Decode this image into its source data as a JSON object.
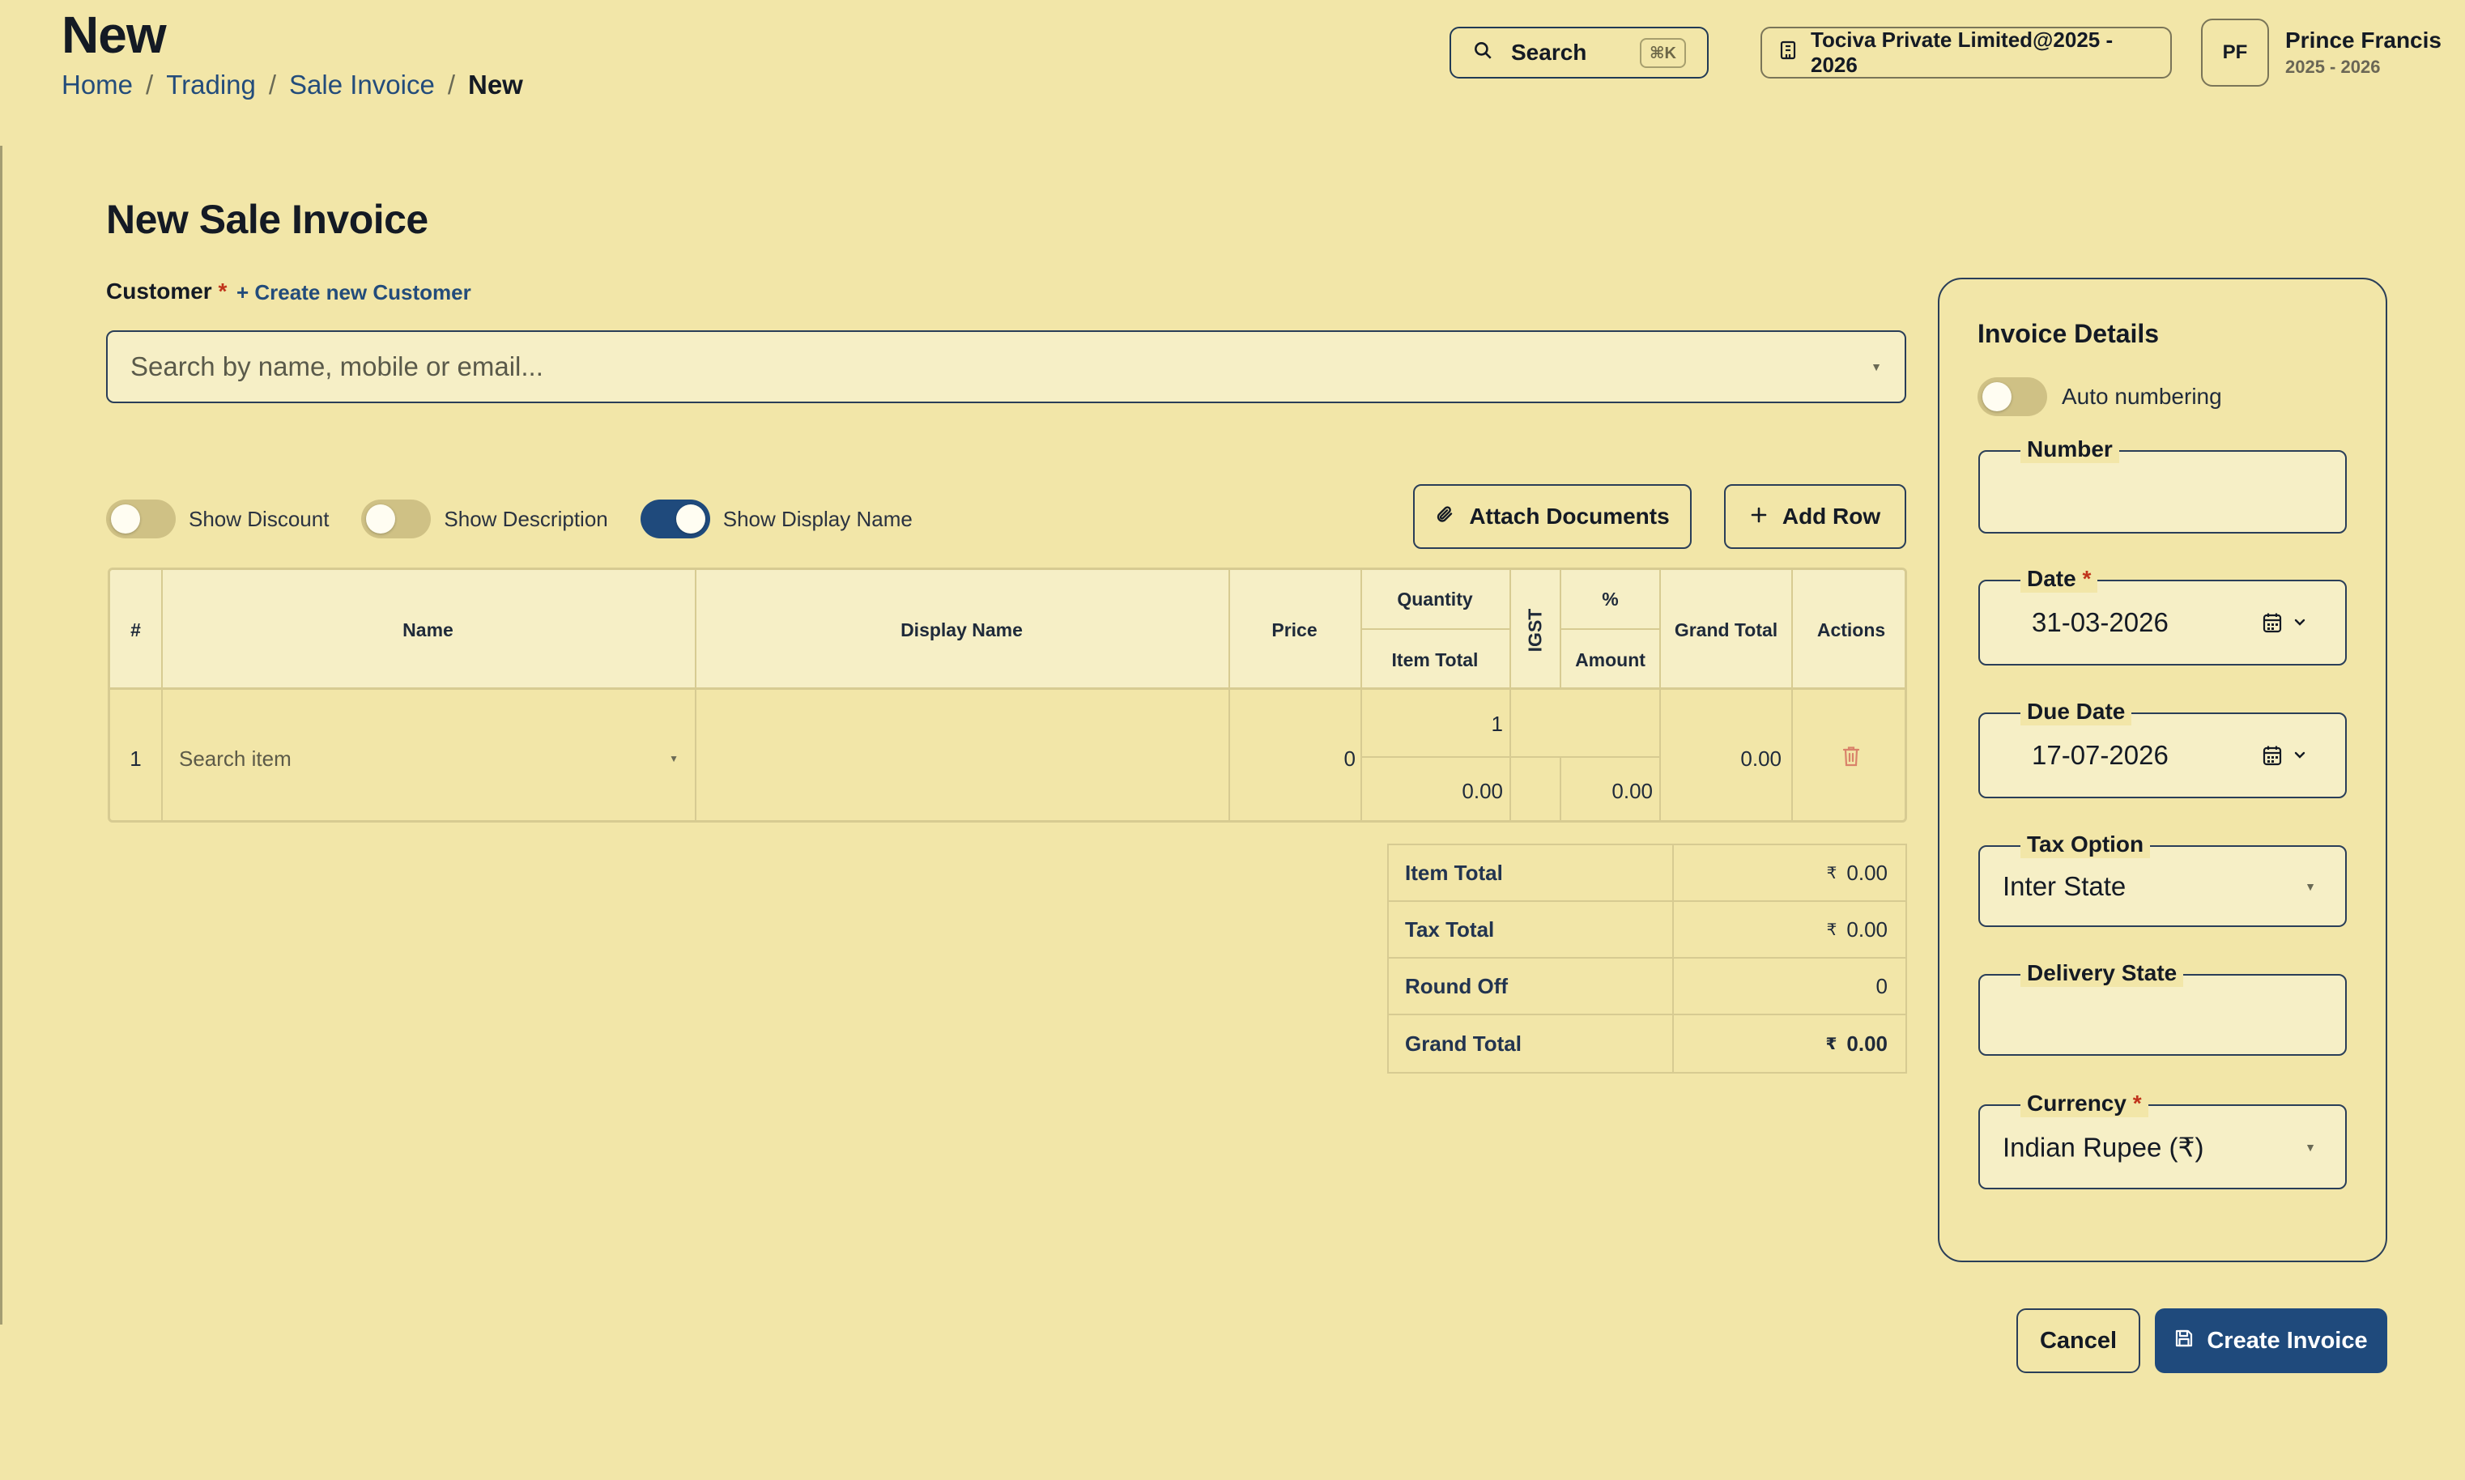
{
  "header": {
    "page_heading": "New",
    "breadcrumb": [
      "Home",
      "Trading",
      "Sale Invoice",
      "New"
    ],
    "search_label": "Search",
    "search_shortcut": "⌘K",
    "company": "Tociva Private Limited@2025 - 2026",
    "user": {
      "initials": "PF",
      "name": "Prince Francis",
      "period": "2025 - 2026"
    }
  },
  "form": {
    "title": "New Sale Invoice",
    "customer_label": "Customer",
    "required_mark": "*",
    "create_customer_link": "+ Create new Customer",
    "customer_placeholder": "Search by name, mobile or email..."
  },
  "toggles": [
    {
      "label": "Show Discount",
      "on": false
    },
    {
      "label": "Show Description",
      "on": false
    },
    {
      "label": "Show Display Name",
      "on": true
    }
  ],
  "actions": {
    "attach": "Attach Documents",
    "add_row": "Add Row"
  },
  "table": {
    "headers": {
      "index": "#",
      "name": "Name",
      "display_name": "Display Name",
      "price": "Price",
      "quantity": "Quantity",
      "item_total": "Item Total",
      "tax": "IGST",
      "percent": "%",
      "amount": "Amount",
      "grand_total": "Grand Total",
      "actions": "Actions"
    },
    "rows": [
      {
        "index": "1",
        "item_placeholder": "Search item",
        "price": "0",
        "quantity": "1",
        "item_total": "0.00",
        "amount": "0.00",
        "grand_total": "0.00"
      }
    ]
  },
  "totals": {
    "currency_symbol": "₹",
    "rows": [
      {
        "label": "Item Total",
        "value": "0.00"
      },
      {
        "label": "Tax Total",
        "value": "0.00"
      },
      {
        "label": "Round Off",
        "value": "0"
      },
      {
        "label": "Grand Total",
        "value": "0.00"
      }
    ]
  },
  "details": {
    "title": "Invoice Details",
    "auto_numbering_label": "Auto numbering",
    "auto_numbering_on": false,
    "number_label": "Number",
    "number_value": "",
    "date_label": "Date",
    "date_value": "31-03-2026",
    "due_date_label": "Due Date",
    "due_date_value": "17-07-2026",
    "tax_option_label": "Tax Option",
    "tax_option_value": "Inter State",
    "delivery_state_label": "Delivery State",
    "delivery_state_value": "",
    "currency_label": "Currency",
    "currency_value": "Indian Rupee (₹)"
  },
  "footer": {
    "cancel": "Cancel",
    "create": "Create Invoice"
  },
  "colors": {
    "background": "#f2e6a8",
    "primary": "#1f4a7c",
    "required": "#c0331b",
    "delete_icon": "#d9826a"
  }
}
